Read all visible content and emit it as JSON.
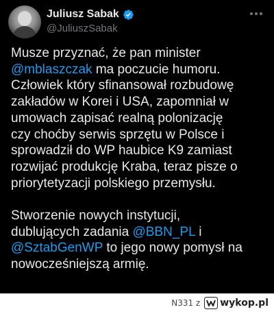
{
  "author": {
    "name": "Juliusz Sabak",
    "handle": "@JuliuszSabak",
    "verified_color": "#1d9bf0"
  },
  "tweet": {
    "lines": [
      [
        {
          "t": "Musze przyznać, że pan minister"
        }
      ],
      [
        {
          "t": "@mblaszczak",
          "m": true
        },
        {
          "t": " ma poczucie humoru."
        }
      ],
      [
        {
          "t": "Człowiek który sfinansował rozbudowę"
        }
      ],
      [
        {
          "t": "zakładów w Korei i USA, zapomniał w"
        }
      ],
      [
        {
          "t": "umowach zapisać realną polonizację"
        }
      ],
      [
        {
          "t": "czy choćby serwis sprzętu w Polsce i"
        }
      ],
      [
        {
          "t": "sprowadził do WP haubice K9 zamiast"
        }
      ],
      [
        {
          "t": "rozwijać produkcję Kraba, teraz pisze o"
        }
      ],
      [
        {
          "t": "priorytetyzacji polskiego przemysłu."
        }
      ],
      [],
      [
        {
          "t": "Stworzenie nowych instytucji,"
        }
      ],
      [
        {
          "t": "dublujących zadania "
        },
        {
          "t": "@BBN_PL",
          "m": true
        },
        {
          "t": " i"
        }
      ],
      [
        {
          "t": "@SztabGenWP",
          "m": true
        },
        {
          "t": " to jego nowy pomysł na"
        }
      ],
      [
        {
          "t": "nowocześniejszą armię."
        }
      ]
    ]
  },
  "footer": {
    "watermark": "N331 z",
    "logo_text": "wykop.pl"
  },
  "colors": {
    "background": "#000000",
    "text": "#e7e9ea",
    "muted": "#71767b",
    "mention": "#1d9bf0"
  }
}
